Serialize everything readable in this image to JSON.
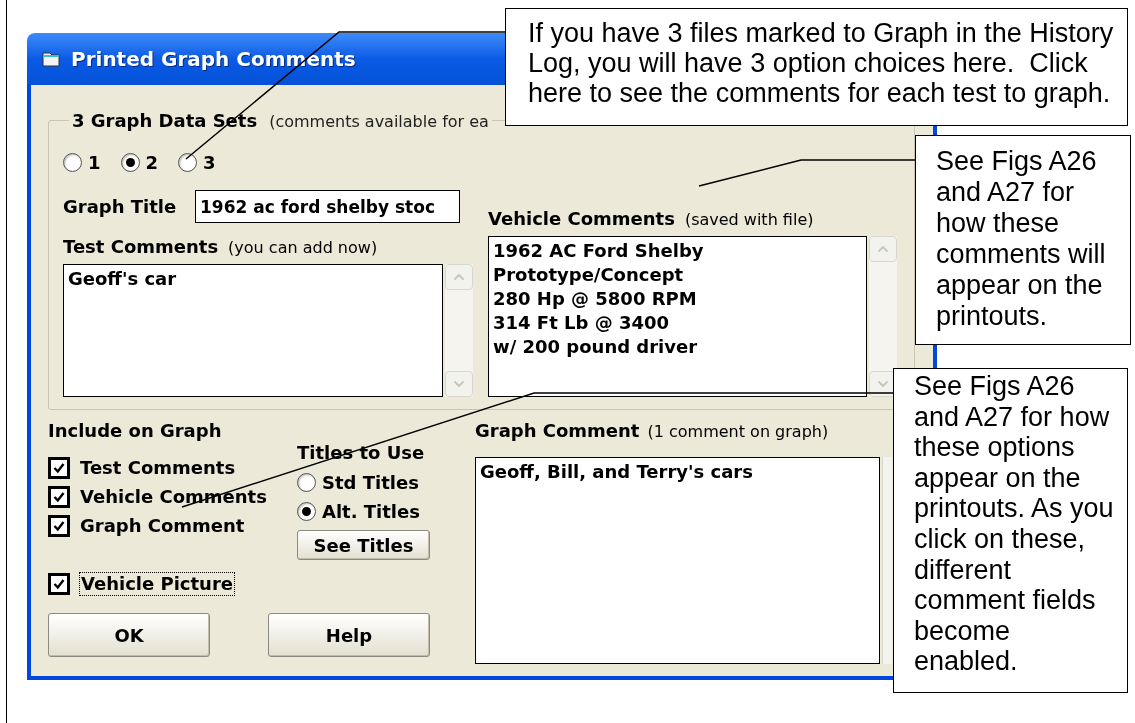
{
  "window": {
    "title": "Printed Graph Comments"
  },
  "data_sets": {
    "title": "3 Graph Data Sets",
    "note": "(comments available for ea",
    "options": [
      {
        "label": "1",
        "selected": false
      },
      {
        "label": "2",
        "selected": true
      },
      {
        "label": "3",
        "selected": false
      }
    ]
  },
  "graph_title": {
    "label": "Graph Title",
    "value": "1962 ac ford shelby stoc"
  },
  "test_comments": {
    "label": "Test Comments",
    "note": "(you can add now)",
    "value": "Geoff's car"
  },
  "vehicle_comments": {
    "label": "Vehicle Comments",
    "note": "(saved with file)",
    "value": "1962 AC Ford Shelby\nPrototype/Concept\n280 Hp @ 5800 RPM\n314 Ft Lb @ 3400\nw/ 200 pound driver"
  },
  "include_on_graph": {
    "title": "Include on Graph",
    "items": [
      {
        "label": "Test Comments",
        "checked": true
      },
      {
        "label": "Vehicle Comments",
        "checked": true
      },
      {
        "label": "Graph Comment",
        "checked": true
      }
    ]
  },
  "vehicle_picture": {
    "label": "Vehicle Picture",
    "checked": true
  },
  "titles_to_use": {
    "title": "Titles to Use",
    "options": [
      {
        "label": "Std Titles",
        "selected": false
      },
      {
        "label": "Alt. Titles",
        "selected": true
      }
    ],
    "button": "See Titles"
  },
  "graph_comment": {
    "label": "Graph Comment",
    "note": "(1 comment on graph)",
    "value": "Geoff, Bill, and Terry's cars"
  },
  "buttons": [
    "OK",
    "Help"
  ],
  "callouts": [
    {
      "text": "If you have 3 files marked to Graph in the History Log, you will have 3 option choices here.  Click here to see the comments for each test to graph."
    },
    {
      "text": "See Figs A26 and A27 for how these comments will appear on the printouts."
    },
    {
      "text": "See Figs A26 and A27 for how these options appear on the printouts. As you click on these, different comment fields become enabled."
    }
  ]
}
